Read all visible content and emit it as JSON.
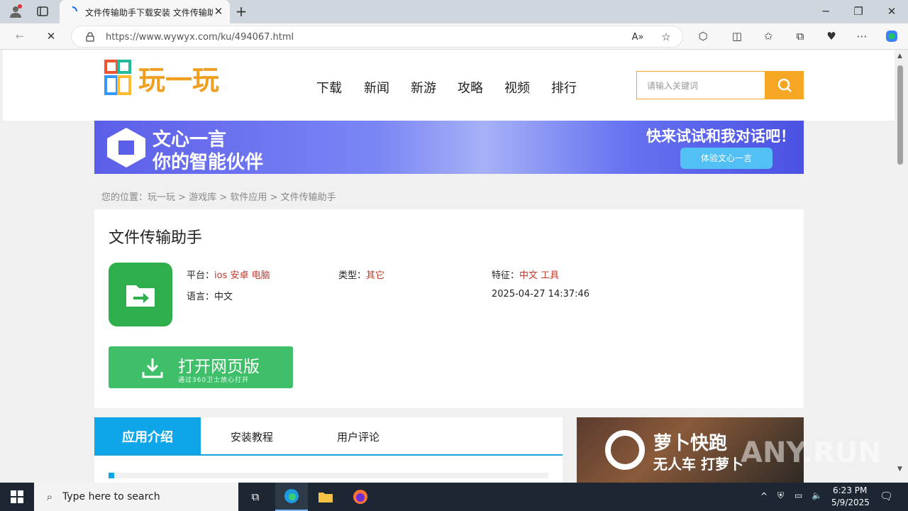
{
  "browser": {
    "tab_title": "文件传输助手下载安装 文件传输助",
    "url": "https://www.wywyx.com/ku/494067.html",
    "url_host_display": "https://www.wywyx.com/ku/494067.html"
  },
  "site": {
    "logo_text": "玩一玩",
    "nav": [
      "下载",
      "新闻",
      "新游",
      "攻略",
      "视频",
      "排行"
    ],
    "search_placeholder": "请输入关键词"
  },
  "banner": {
    "title": "文心一言",
    "subtitle": "你的智能伙伴",
    "cta_text": "快来试试和我对话吧！",
    "cta_button": "体验文心一言"
  },
  "breadcrumb": {
    "prefix": "您的位置：",
    "items": [
      "玩一玩",
      "游戏库",
      "软件应用",
      "文件传输助手"
    ],
    "sep": ">"
  },
  "app": {
    "title": "文件传输助手",
    "platform_label": "平台：",
    "platform_values": "ios 安卓 电脑",
    "type_label": "类型：",
    "type_value": "其它",
    "feature_label": "特征：",
    "feature_values": "中文 工具",
    "language_label": "语言：",
    "language_value": "中文",
    "date": "2025-04-27 14:37:46",
    "open_button": "打开网页版",
    "open_button_sub": "通过360卫士放心打开"
  },
  "tabs": {
    "intro": "应用介绍",
    "tutorial": "安装教程",
    "reviews": "用户评论"
  },
  "ad2": {
    "title": "萝卜快跑",
    "subtitle": "无人车 打萝卜"
  },
  "watermark": "ANY.RUN",
  "taskbar": {
    "search_placeholder": "Type here to search",
    "time": "6:23 PM",
    "date": "5/9/2025"
  },
  "colors": {
    "accent_orange": "#f5a623",
    "tab_blue": "#0ea5e9",
    "app_green": "#2faf4b",
    "button_green": "#3fbf6a",
    "link_red": "#c0392b"
  }
}
